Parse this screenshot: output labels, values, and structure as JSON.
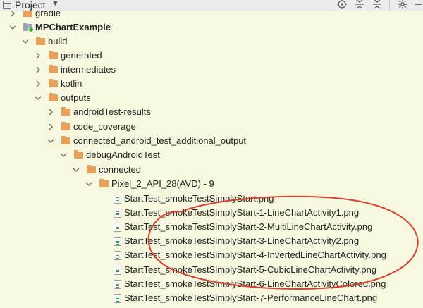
{
  "toolbar": {
    "title": "Project",
    "caret": "▼",
    "icons": [
      "locate-icon",
      "expand-all-icon",
      "collapse-all-icon",
      "settings-icon"
    ]
  },
  "tree": {
    "rows": [
      {
        "label": "gradle",
        "type": "folder",
        "expanded": false
      },
      {
        "label": "MPChartExample",
        "type": "module",
        "expanded": true,
        "bold": true
      },
      {
        "label": "build",
        "type": "folder",
        "expanded": true
      },
      {
        "label": "generated",
        "type": "folder",
        "expanded": false
      },
      {
        "label": "intermediates",
        "type": "folder",
        "expanded": false
      },
      {
        "label": "kotlin",
        "type": "folder",
        "expanded": false
      },
      {
        "label": "outputs",
        "type": "folder",
        "expanded": true
      },
      {
        "label": "androidTest-results",
        "type": "folder",
        "expanded": false
      },
      {
        "label": "code_coverage",
        "type": "folder",
        "expanded": false
      },
      {
        "label": "connected_android_test_additional_output",
        "type": "folder",
        "expanded": true
      },
      {
        "label": "debugAndroidTest",
        "type": "folder",
        "expanded": true
      },
      {
        "label": "connected",
        "type": "folder",
        "expanded": true
      },
      {
        "label": "Pixel_2_API_28(AVD) - 9",
        "type": "folder",
        "expanded": true
      },
      {
        "label": "StartTest_smokeTestSimplyStart.png",
        "type": "file"
      },
      {
        "label": "StartTest_smokeTestSimplyStart-1-LineChartActivity1.png",
        "type": "file"
      },
      {
        "label": "StartTest_smokeTestSimplyStart-2-MultiLineChartActivity.png",
        "type": "file"
      },
      {
        "label": "StartTest_smokeTestSimplyStart-3-LineChartActivity2.png",
        "type": "file"
      },
      {
        "label": "StartTest_smokeTestSimplyStart-4-InvertedLineChartActivity.png",
        "type": "file"
      },
      {
        "label": "StartTest_smokeTestSimplyStart-5-CubicLineChartActivity.png",
        "type": "file"
      },
      {
        "label": "StartTest_smokeTestSimplyStart-6-LineChartActivityColored.png",
        "type": "file"
      },
      {
        "label": "StartTest_smokeTestSimplyStart-7-PerformanceLineChart.png",
        "type": "file"
      }
    ]
  },
  "colors": {
    "background": "#f8f8e0",
    "folder": "#e8a15a",
    "annotation": "#d8402c"
  }
}
